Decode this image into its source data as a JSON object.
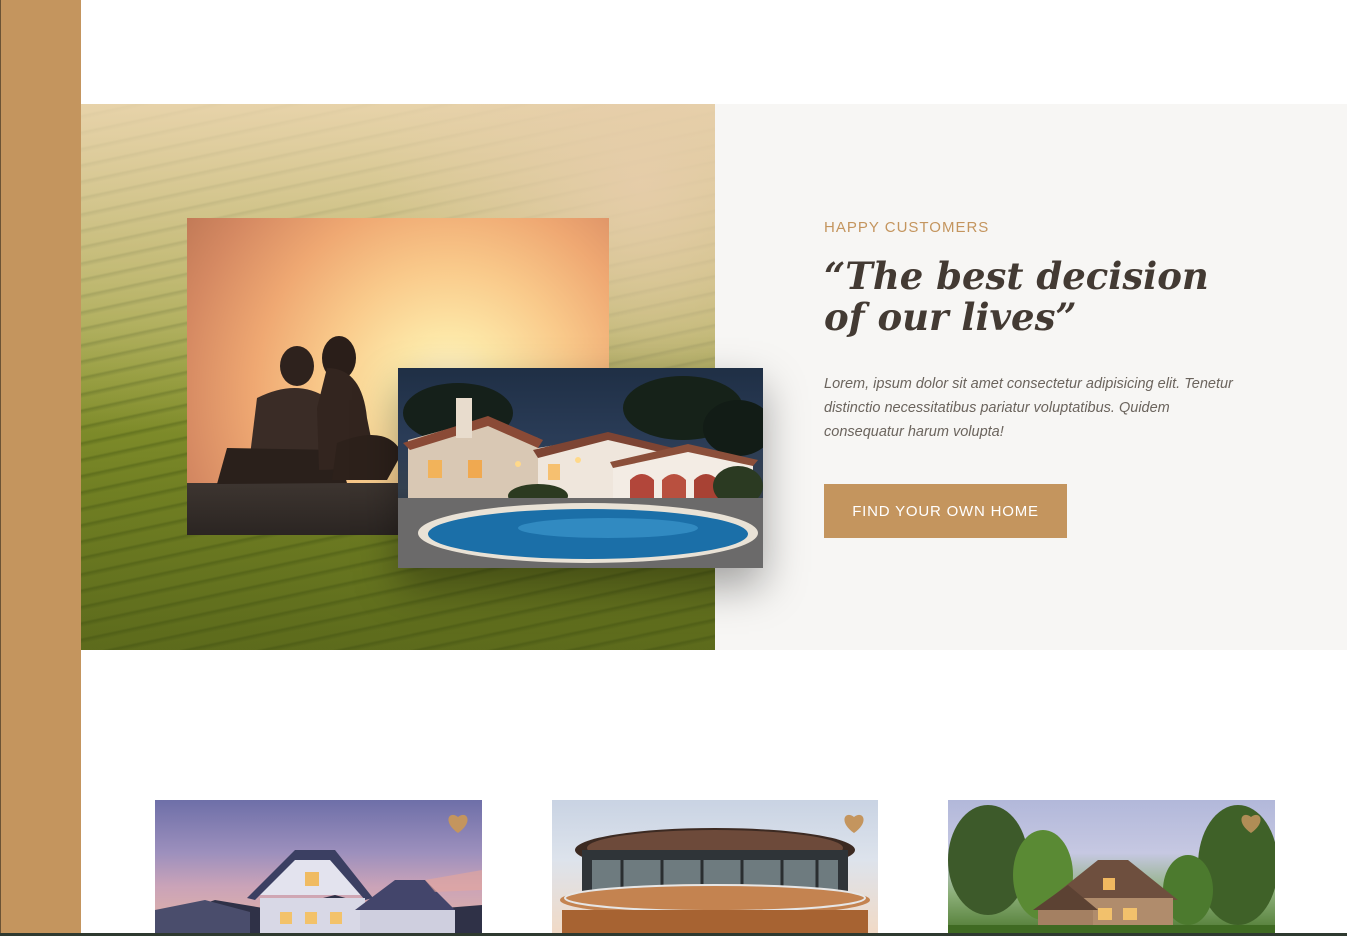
{
  "story": {
    "eyebrow": "HAPPY CUSTOMERS",
    "quote": "“The best decision of our lives”",
    "paragraph": "Lorem, ipsum dolor sit amet consectetur adipisicing elit. Tenetur distinctio necessitatibus pariatur voluptatibus. Quidem consequatur harum volupta!",
    "cta_label": "FIND YOUR OWN HOME"
  },
  "images": {
    "background": "tea-plantation-hills",
    "photo_1": "couple-watching-sunset",
    "photo_2": "villa-with-pool-at-night"
  },
  "listings": [
    {
      "image": "suburban-house-at-dusk",
      "favorite_icon": "heart-icon"
    },
    {
      "image": "round-modern-house",
      "favorite_icon": "heart-icon"
    },
    {
      "image": "stone-house-in-forest",
      "favorite_icon": "heart-icon"
    }
  ],
  "colors": {
    "accent": "#c4955e",
    "heading": "#433a33",
    "body_text": "#6b645d",
    "panel_bg": "#f7f6f4"
  }
}
